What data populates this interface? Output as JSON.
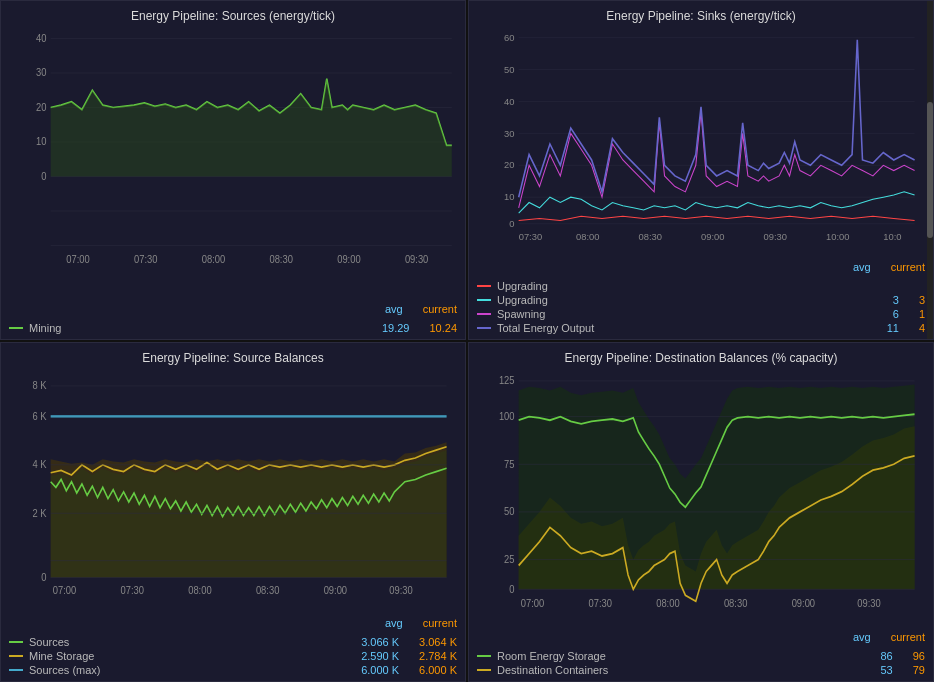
{
  "panels": [
    {
      "id": "sources",
      "title": "Energy Pipeline: Sources (energy/tick)",
      "legend_headers": {
        "avg": "avg",
        "cur": "current"
      },
      "legend_items": [
        {
          "label": "Mining",
          "color": "#66cc44",
          "avg": "19.29",
          "cur": "10.24"
        }
      ],
      "y_axis": [
        "40",
        "30",
        "20",
        "10",
        "0"
      ],
      "x_axis": [
        "07:00",
        "07:30",
        "08:00",
        "08:30",
        "09:00",
        "09:30"
      ]
    },
    {
      "id": "sinks",
      "title": "Energy Pipeline: Sinks (energy/tick)",
      "legend_headers": {
        "avg": "avg",
        "cur": "current"
      },
      "legend_items": [
        {
          "label": "Upgrading",
          "color": "#ff4444",
          "avg": "",
          "cur": ""
        },
        {
          "label": "Upgrading",
          "color": "#44dddd",
          "avg": "3",
          "cur": "3"
        },
        {
          "label": "Spawning",
          "color": "#cc44cc",
          "avg": "6",
          "cur": "1"
        },
        {
          "label": "Total Energy Output",
          "color": "#6666cc",
          "avg": "11",
          "cur": "4"
        }
      ],
      "y_axis": [
        "60",
        "50",
        "40",
        "30",
        "20",
        "10",
        "0"
      ],
      "x_axis": [
        "07:30",
        "08:00",
        "08:30",
        "09:00",
        "09:30",
        "10:00",
        "10:0"
      ]
    },
    {
      "id": "source-balances",
      "title": "Energy Pipeline: Source Balances",
      "legend_headers": {
        "avg": "avg",
        "cur": "current"
      },
      "legend_items": [
        {
          "label": "Sources",
          "color": "#66cc44",
          "avg": "3.066 K",
          "cur": "3.064 K"
        },
        {
          "label": "Mine Storage",
          "color": "#ccaa22",
          "avg": "2.590 K",
          "cur": "2.784 K"
        },
        {
          "label": "Sources (max)",
          "color": "#44aacc",
          "avg": "6.000 K",
          "cur": "6.000 K"
        }
      ],
      "y_axis": [
        "8 K",
        "6 K",
        "4 K",
        "2 K",
        "0"
      ],
      "x_axis": [
        "07:00",
        "07:30",
        "08:00",
        "08:30",
        "09:00",
        "09:30"
      ]
    },
    {
      "id": "dest-balances",
      "title": "Energy Pipeline: Destination Balances (% capacity)",
      "legend_headers": {
        "avg": "avg",
        "cur": "current"
      },
      "legend_items": [
        {
          "label": "Room Energy Storage",
          "color": "#66cc44",
          "avg": "86",
          "cur": "96"
        },
        {
          "label": "Destination Containers",
          "color": "#ccaa22",
          "avg": "53",
          "cur": "79"
        }
      ],
      "y_axis": [
        "125",
        "100",
        "75",
        "50",
        "25",
        "0"
      ],
      "x_axis": [
        "07:00",
        "07:30",
        "08:00",
        "08:30",
        "09:00",
        "09:30"
      ]
    }
  ]
}
